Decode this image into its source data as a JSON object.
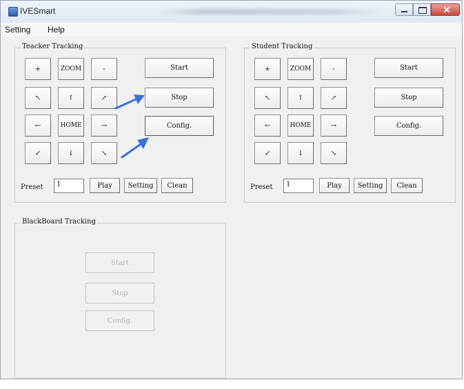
{
  "window": {
    "title": "IVESmart"
  },
  "menu": {
    "items": [
      "Setting",
      "Help"
    ]
  },
  "teacher": {
    "title": "Teacker Tracking",
    "ptz": [
      "+",
      "ZOOM",
      "-",
      "↖",
      "↑",
      "↗",
      "←",
      "HOME",
      "→",
      "↙",
      "↓",
      "↘"
    ],
    "actions": [
      "Start",
      "Stop",
      "Config."
    ],
    "preset_label": "Preset",
    "preset_value": "1",
    "preset_buttons": [
      "Play",
      "Setting",
      "Clean"
    ]
  },
  "student": {
    "title": "Student Tracking",
    "ptz": [
      "+",
      "ZOOM",
      "-",
      "↖",
      "↑",
      "↗",
      "←",
      "HOME",
      "→",
      "↙",
      "↓",
      "↘"
    ],
    "actions": [
      "Start",
      "Stop",
      "Config."
    ],
    "preset_label": "Preset",
    "preset_value": "1",
    "preset_buttons": [
      "Play",
      "Setting",
      "Clean"
    ]
  },
  "blackboard": {
    "title": "BlackBoard Tracking",
    "actions": [
      "Start",
      "Stop",
      "Config."
    ]
  },
  "colors": {
    "annotation_arrow": "#3a6fe0"
  }
}
